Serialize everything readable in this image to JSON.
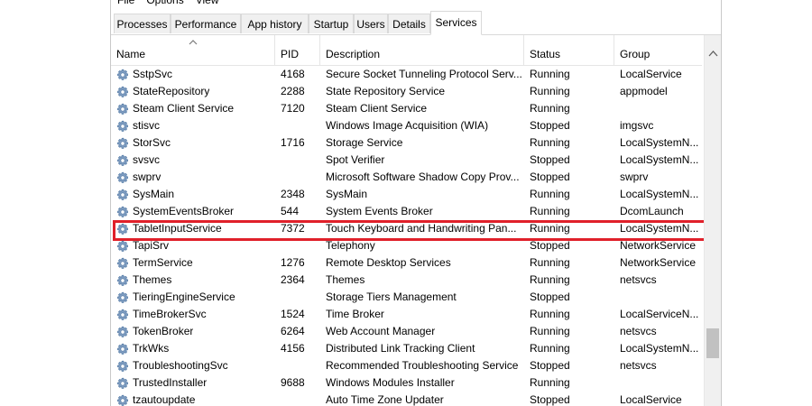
{
  "menu": {
    "file": "File",
    "options": "Options",
    "view": "View"
  },
  "tabs": [
    {
      "label": "Processes",
      "active": false
    },
    {
      "label": "Performance",
      "active": false
    },
    {
      "label": "App history",
      "active": false
    },
    {
      "label": "Startup",
      "active": false
    },
    {
      "label": "Users",
      "active": false
    },
    {
      "label": "Details",
      "active": false
    },
    {
      "label": "Services",
      "active": true
    }
  ],
  "columns": {
    "name": "Name",
    "pid": "PID",
    "description": "Description",
    "status": "Status",
    "group": "Group"
  },
  "icons": {
    "service": "gear-icon",
    "sort": "sort-ascending-icon"
  },
  "colors": {
    "highlight": "#e0202a",
    "gear": "#4a7bb0"
  },
  "rows": [
    {
      "name": "SstpSvc",
      "pid": "4168",
      "description": "Secure Socket Tunneling Protocol Serv...",
      "status": "Running",
      "group": "LocalService"
    },
    {
      "name": "StateRepository",
      "pid": "2288",
      "description": "State Repository Service",
      "status": "Running",
      "group": "appmodel"
    },
    {
      "name": "Steam Client Service",
      "pid": "7120",
      "description": "Steam Client Service",
      "status": "Running",
      "group": ""
    },
    {
      "name": "stisvc",
      "pid": "",
      "description": "Windows Image Acquisition (WIA)",
      "status": "Stopped",
      "group": "imgsvc"
    },
    {
      "name": "StorSvc",
      "pid": "1716",
      "description": "Storage Service",
      "status": "Running",
      "group": "LocalSystemN..."
    },
    {
      "name": "svsvc",
      "pid": "",
      "description": "Spot Verifier",
      "status": "Stopped",
      "group": "LocalSystemN..."
    },
    {
      "name": "swprv",
      "pid": "",
      "description": "Microsoft Software Shadow Copy Prov...",
      "status": "Stopped",
      "group": "swprv"
    },
    {
      "name": "SysMain",
      "pid": "2348",
      "description": "SysMain",
      "status": "Running",
      "group": "LocalSystemN..."
    },
    {
      "name": "SystemEventsBroker",
      "pid": "544",
      "description": "System Events Broker",
      "status": "Running",
      "group": "DcomLaunch"
    },
    {
      "name": "TabletInputService",
      "pid": "7372",
      "description": "Touch Keyboard and Handwriting Pan...",
      "status": "Running",
      "group": "LocalSystemN...",
      "highlighted": true
    },
    {
      "name": "TapiSrv",
      "pid": "",
      "description": "Telephony",
      "status": "Stopped",
      "group": "NetworkService"
    },
    {
      "name": "TermService",
      "pid": "1276",
      "description": "Remote Desktop Services",
      "status": "Running",
      "group": "NetworkService"
    },
    {
      "name": "Themes",
      "pid": "2364",
      "description": "Themes",
      "status": "Running",
      "group": "netsvcs"
    },
    {
      "name": "TieringEngineService",
      "pid": "",
      "description": "Storage Tiers Management",
      "status": "Stopped",
      "group": ""
    },
    {
      "name": "TimeBrokerSvc",
      "pid": "1524",
      "description": "Time Broker",
      "status": "Running",
      "group": "LocalServiceN..."
    },
    {
      "name": "TokenBroker",
      "pid": "6264",
      "description": "Web Account Manager",
      "status": "Running",
      "group": "netsvcs"
    },
    {
      "name": "TrkWks",
      "pid": "4156",
      "description": "Distributed Link Tracking Client",
      "status": "Running",
      "group": "LocalSystemN..."
    },
    {
      "name": "TroubleshootingSvc",
      "pid": "",
      "description": "Recommended Troubleshooting Service",
      "status": "Stopped",
      "group": "netsvcs"
    },
    {
      "name": "TrustedInstaller",
      "pid": "9688",
      "description": "Windows Modules Installer",
      "status": "Running",
      "group": ""
    },
    {
      "name": "tzautoupdate",
      "pid": "",
      "description": "Auto Time Zone Updater",
      "status": "Stopped",
      "group": "LocalService"
    }
  ]
}
